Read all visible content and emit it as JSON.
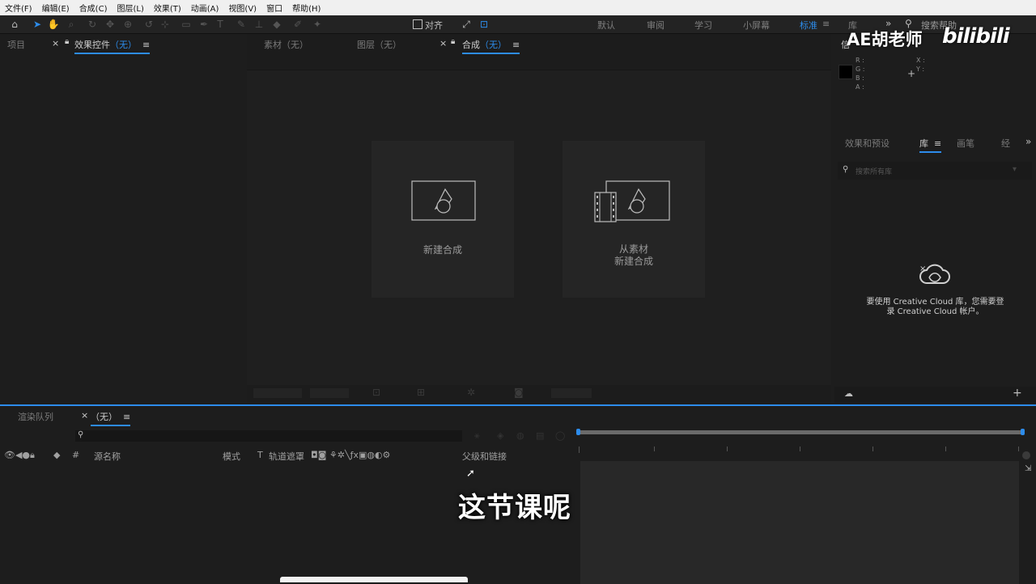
{
  "menu": [
    "文件(F)",
    "编辑(E)",
    "合成(C)",
    "图层(L)",
    "效果(T)",
    "动画(A)",
    "视图(V)",
    "窗口",
    "帮助(H)"
  ],
  "toolbar": {
    "align_label": "对齐",
    "workspaces": [
      "默认",
      "审阅",
      "学习",
      "小屏幕",
      "标准",
      "库"
    ],
    "active_workspace": "标准",
    "search_placeholder": "搜索帮助"
  },
  "left_panel": {
    "tabs": [
      "项目",
      "效果控件",
      "（无）"
    ]
  },
  "viewer": {
    "tabs": [
      "素材（无）",
      "图层（无）",
      "合成",
      "（无）"
    ],
    "new_comp_label": "新建合成",
    "from_footage_line1": "从素材",
    "from_footage_line2": "新建合成"
  },
  "info_panel": {
    "tab": "信",
    "rgba": [
      "R :",
      "G :",
      "B :",
      "A :"
    ],
    "xy": [
      "X :",
      "Y :"
    ]
  },
  "library_panel": {
    "tabs": [
      "效果和预设",
      "库",
      "画笔",
      "经"
    ],
    "search_placeholder": "搜索所有库",
    "message_line1": "要使用 Creative Cloud 库，您需要登",
    "message_line2": "录 Creative Cloud 帐户。"
  },
  "timeline": {
    "tabs": [
      "渲染队列",
      "（无）"
    ],
    "columns": {
      "hash": "#",
      "source_name": "源名称",
      "mode": "模式",
      "t": "T",
      "track_matte": "轨道遮罩",
      "parent": "父级和链接"
    }
  },
  "overlay": {
    "subtitle": "这节课呢",
    "watermark": "AE胡老师",
    "logo": "bilibili"
  },
  "colors": {
    "accent": "#2d8ceb",
    "panel_bg": "#1d1d1d",
    "card_bg": "#252525",
    "menubar_bg": "#f0f0f0"
  }
}
